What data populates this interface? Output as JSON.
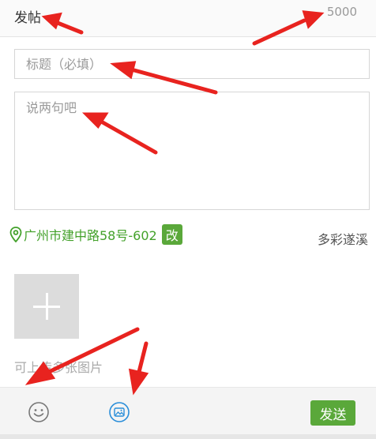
{
  "header": {
    "title": "发帖",
    "char_count": "5000"
  },
  "form": {
    "title_placeholder": "标题（必填）",
    "content_placeholder": "说两句吧"
  },
  "location": {
    "address": "广州市建中路58号-602",
    "edit_label": "改"
  },
  "circle": {
    "name": "多彩遂溪"
  },
  "upload": {
    "hint": "可上传多张图片"
  },
  "toolbar": {
    "send_label": "发送",
    "emoji_icon": "smiley-icon",
    "image_icon": "image-icon"
  },
  "colors": {
    "accent": "#5aa83a",
    "annotation": "#e8231f"
  }
}
